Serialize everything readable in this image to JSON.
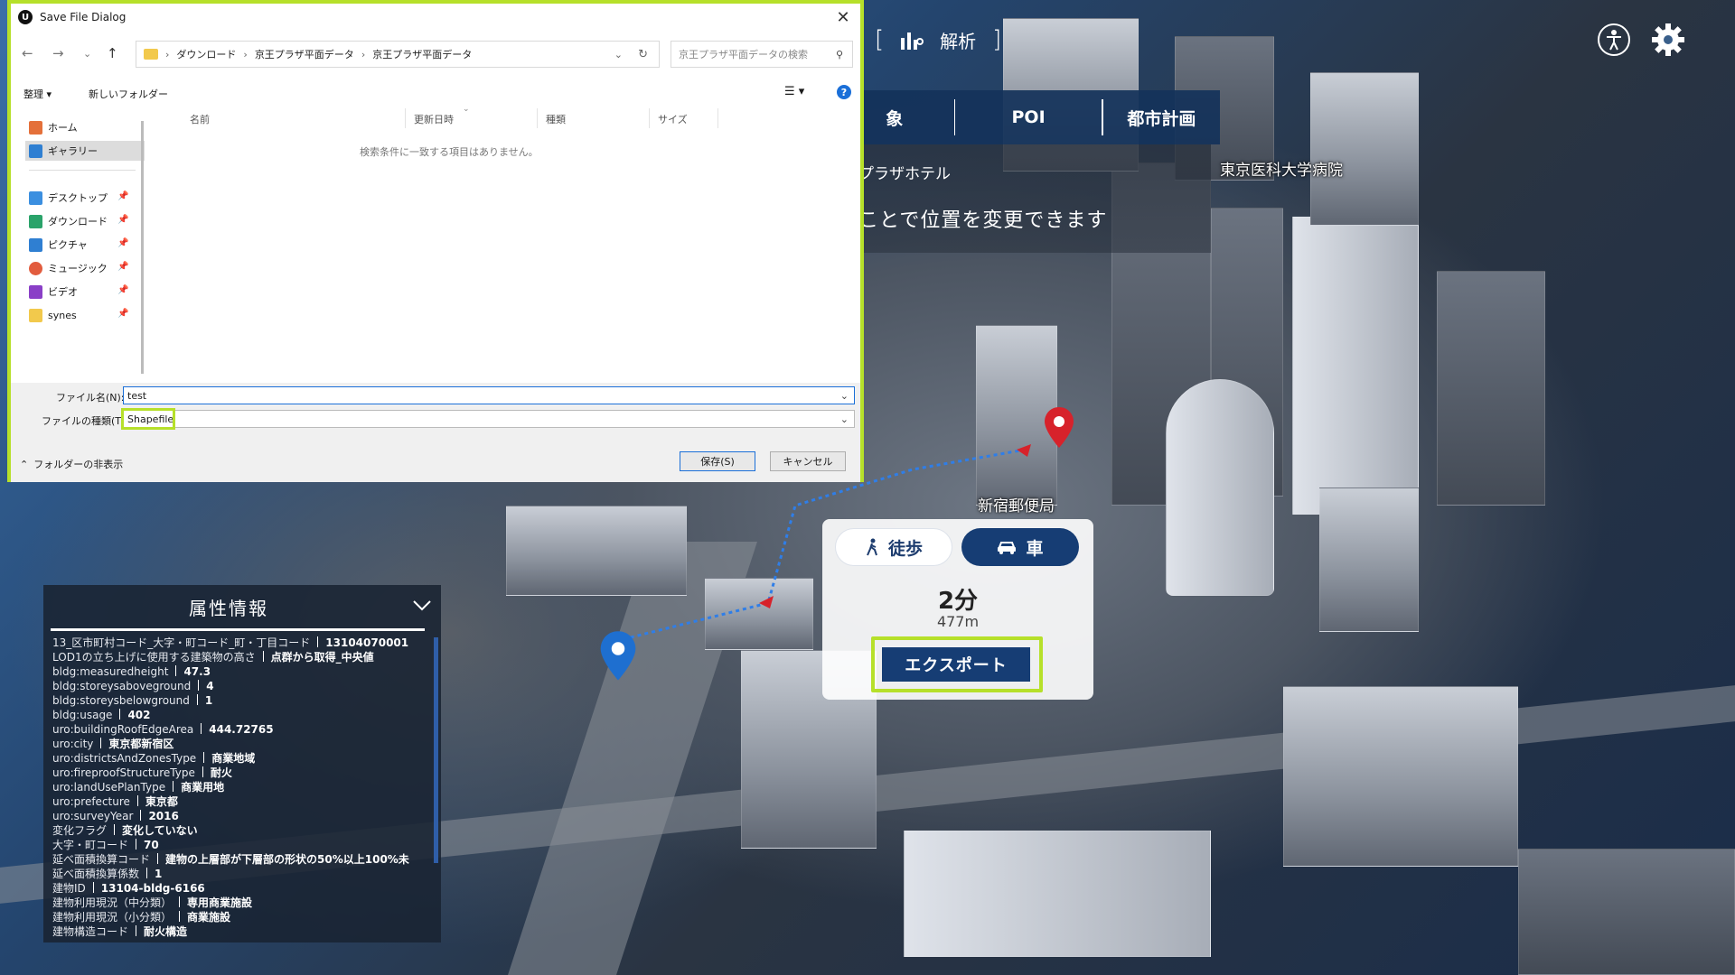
{
  "dialog": {
    "title": "Save File Dialog",
    "app_icon": "U",
    "close": "✕",
    "breadcrumb": [
      "ダウンロード",
      "京王プラザ平面データ",
      "京王プラザ平面データ"
    ],
    "search_placeholder": "京王プラザ平面データの検索",
    "organize": "整理 ▾",
    "new_folder": "新しいフォルダー",
    "nav_items": [
      {
        "label": "ホーム",
        "icon": "home-icon"
      },
      {
        "label": "ギャラリー",
        "icon": "gallery-icon"
      },
      {
        "label": "デスクトップ",
        "icon": "desktop-icon"
      },
      {
        "label": "ダウンロード",
        "icon": "download-icon"
      },
      {
        "label": "ピクチャ",
        "icon": "pictures-icon"
      },
      {
        "label": "ミュージック",
        "icon": "music-icon"
      },
      {
        "label": "ビデオ",
        "icon": "video-icon"
      },
      {
        "label": "synes",
        "icon": "folder-icon"
      }
    ],
    "columns": [
      "名前",
      "更新日時",
      "種類",
      "サイズ"
    ],
    "empty_message": "検索条件に一致する項目はありません。",
    "filename_label": "ファイル名(N):",
    "filename_value": "test",
    "filetype_label": "ファイルの種類(T):",
    "filetype_value": "Shapefile",
    "hide_folders": "フォルダーの非表示",
    "save_label": "保存(S)",
    "cancel_label": "キャンセル"
  },
  "topbar": {
    "analysis_label": "解析",
    "bracket_open": "[",
    "bracket_close": "]"
  },
  "tabs": [
    {
      "label": "象"
    },
    {
      "label": "POI"
    },
    {
      "label": "都市計画"
    }
  ],
  "info": {
    "hotel": "プラザホテル",
    "hint": "ことで位置を変更できます"
  },
  "map_labels": {
    "hospital": "東京医科大学病院",
    "post_office": "新宿郵便局"
  },
  "route": {
    "walk_label": "徒歩",
    "car_label": "車",
    "time": "2分",
    "distance": "477m",
    "export_label": "エクスポート"
  },
  "attributes": {
    "title": "属性情報",
    "rows": [
      {
        "k": "13_区市町村コード_大字・町コード_町・丁目コード",
        "v": "13104070001"
      },
      {
        "k": "LOD1の立ち上げに使用する建築物の高さ",
        "v": "点群から取得_中央値"
      },
      {
        "k": "bldg:measuredheight",
        "v": "47.3"
      },
      {
        "k": "bldg:storeysaboveground",
        "v": "4"
      },
      {
        "k": "bldg:storeysbelowground",
        "v": "1"
      },
      {
        "k": "bldg:usage",
        "v": "402"
      },
      {
        "k": "uro:buildingRoofEdgeArea",
        "v": "444.72765"
      },
      {
        "k": "uro:city",
        "v": "東京都新宿区"
      },
      {
        "k": "uro:districtsAndZonesType",
        "v": "商業地域"
      },
      {
        "k": "uro:fireproofStructureType",
        "v": "耐火"
      },
      {
        "k": "uro:landUsePlanType",
        "v": "商業用地"
      },
      {
        "k": "uro:prefecture",
        "v": "東京都"
      },
      {
        "k": "uro:surveyYear",
        "v": "2016"
      },
      {
        "k": "変化フラグ",
        "v": "変化していない"
      },
      {
        "k": "大字・町コード",
        "v": "70"
      },
      {
        "k": "延べ面積換算コード",
        "v": "建物の上層部が下層部の形状の50%以上100%未"
      },
      {
        "k": "延べ面積換算係数",
        "v": "1"
      },
      {
        "k": "建物ID",
        "v": "13104-bldg-6166"
      },
      {
        "k": "建物利用現況（中分類）",
        "v": "専用商業施設"
      },
      {
        "k": "建物利用現況（小分類）",
        "v": "商業施設"
      },
      {
        "k": "建物構造コード",
        "v": "耐火構造"
      }
    ]
  },
  "colors": {
    "highlight": "#b6e02a",
    "accent_blue": "#163d74",
    "pin_red": "#d7222b",
    "pin_blue": "#1e6fd0"
  }
}
